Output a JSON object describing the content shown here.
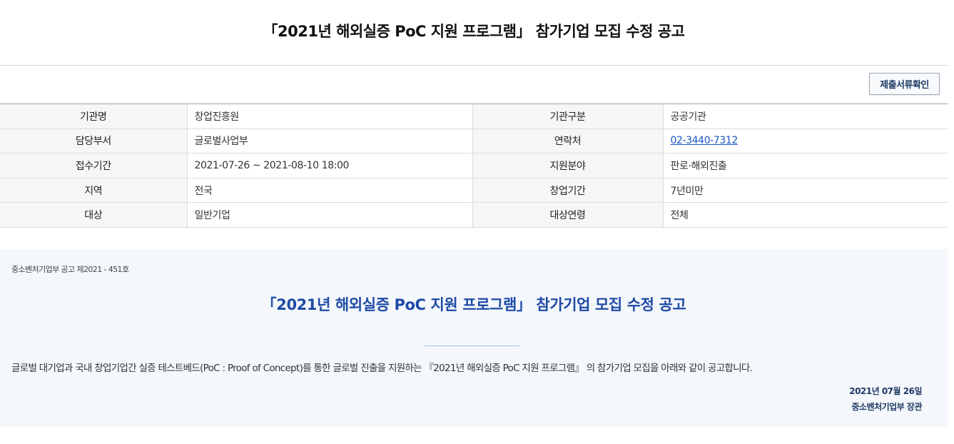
{
  "page_title": "「2021년 해외실증 PoC 지원 프로그램」 참가기업 모집 수정 공고",
  "toolbar": {
    "docs_button_label": "제출서류확인"
  },
  "info_table": {
    "rows": [
      {
        "label1": "기관명",
        "value1": "창업진흥원",
        "label2": "기관구분",
        "value2": "공공기관"
      },
      {
        "label1": "담당부서",
        "value1": "글로벌사업부",
        "label2": "연락처",
        "value2": "02-3440-7312"
      },
      {
        "label1": "접수기간",
        "value1": "2021-07-26 ~ 2021-08-10 18:00",
        "label2": "지원분야",
        "value2": "판로·해외진출"
      },
      {
        "label1": "지역",
        "value1": "전국",
        "label2": "창업기간",
        "value2": "7년미만"
      },
      {
        "label1": "대상",
        "value1": "일반기업",
        "label2": "대상연령",
        "value2": "전체"
      }
    ]
  },
  "notice": {
    "number": "중소벤처기업부 공고 제2021 - 451호",
    "title": "「2021년 해외실증 PoC 지원 프로그램」 참가기업 모집 수정  공고",
    "body": "글로벌 대기업과 국내 창업기업간 실증 테스트베드(PoC : Proof of Concept)를 통한 글로벌 진출을 지원하는 『2021년 해외실증 PoC 지원 프로그램』 의 참가기업 모집을 아래와 같이 공고합니다.",
    "date": "2021년 07월 26일",
    "issuer": "중소벤처기업부 장관"
  },
  "colors": {
    "accent": "#1e4aa6",
    "link": "#1a56c4",
    "notice_bg": "#f4f7fb",
    "label_bg": "#f6f6f6"
  }
}
